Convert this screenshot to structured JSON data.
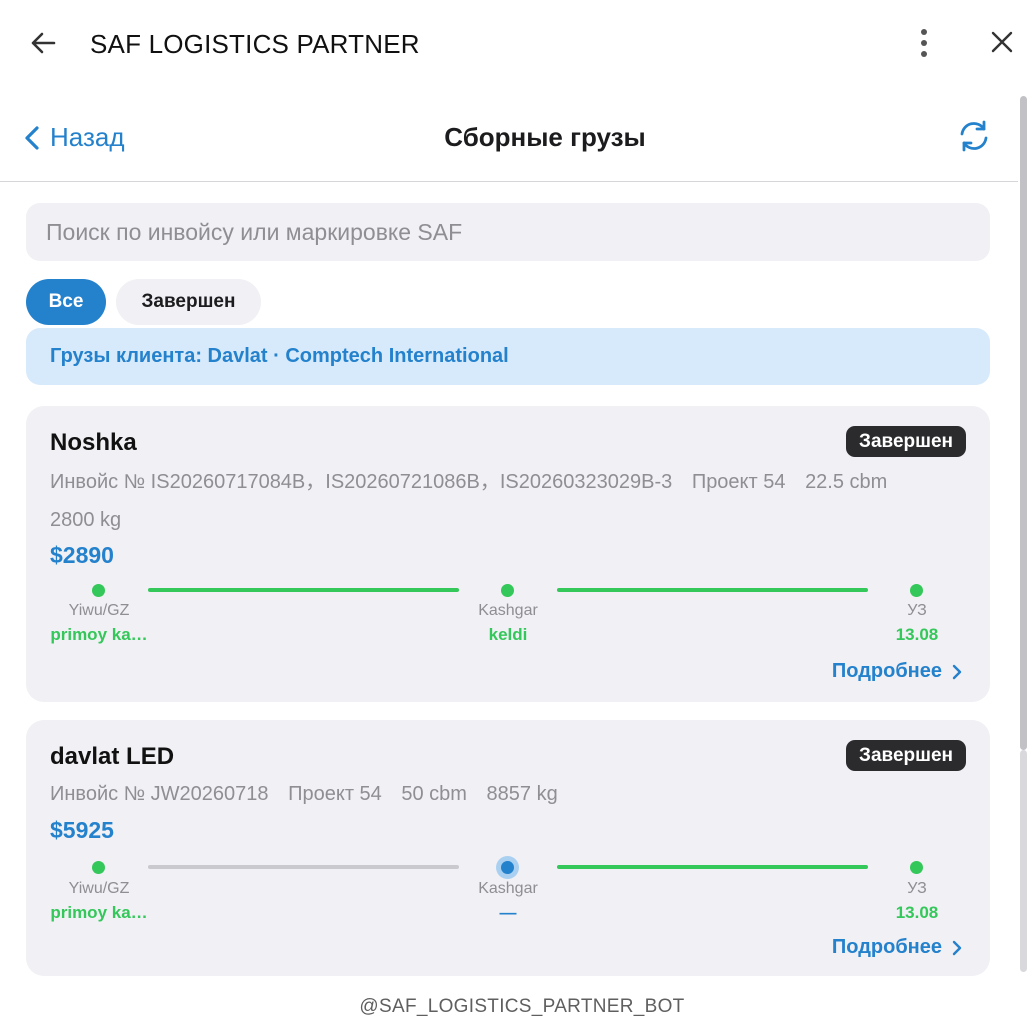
{
  "window": {
    "title": "SAF LOGISTICS PARTNER"
  },
  "nav": {
    "back_label": "Назад",
    "title": "Сборные грузы"
  },
  "search": {
    "placeholder": "Поиск по инвойсу или маркировке SAF",
    "value": ""
  },
  "filters": {
    "all_label": "Все",
    "done_label": "Завершен",
    "active": "Все"
  },
  "client_banner": "Грузы клиента: Davlat · Comptech International",
  "cards": [
    {
      "name": "Noshka",
      "status": "Завершен",
      "invoice": "Инвойс № IS20260717084B，IS20260721086B，IS20260323029B-3",
      "project": "Проект 54",
      "volume": "22.5 cbm",
      "weight": "2800 kg",
      "price": "$2890",
      "stages": [
        {
          "name": "Yiwu/GZ",
          "value": "primoy ka…"
        },
        {
          "name": "Kashgar",
          "value": "keldi"
        },
        {
          "name": "УЗ",
          "value": "13.08"
        }
      ],
      "more_label": "Подробнее"
    },
    {
      "name": "davlat LED",
      "status": "Завершен",
      "invoice": "Инвойс № JW20260718",
      "project": "Проект 54",
      "volume": "50 cbm",
      "weight": "8857 kg",
      "price": "$5925",
      "stages": [
        {
          "name": "Yiwu/GZ",
          "value": "primoy ka…"
        },
        {
          "name": "Kashgar",
          "value": "—"
        },
        {
          "name": "УЗ",
          "value": "13.08"
        }
      ],
      "more_label": "Подробнее"
    }
  ],
  "footer": "@SAF_LOGISTICS_PARTNER_BOT",
  "colors": {
    "accent": "#2481cc",
    "done": "#34c759",
    "card_bg": "#f0f0f5",
    "badge_bg": "#2b2b2d"
  }
}
